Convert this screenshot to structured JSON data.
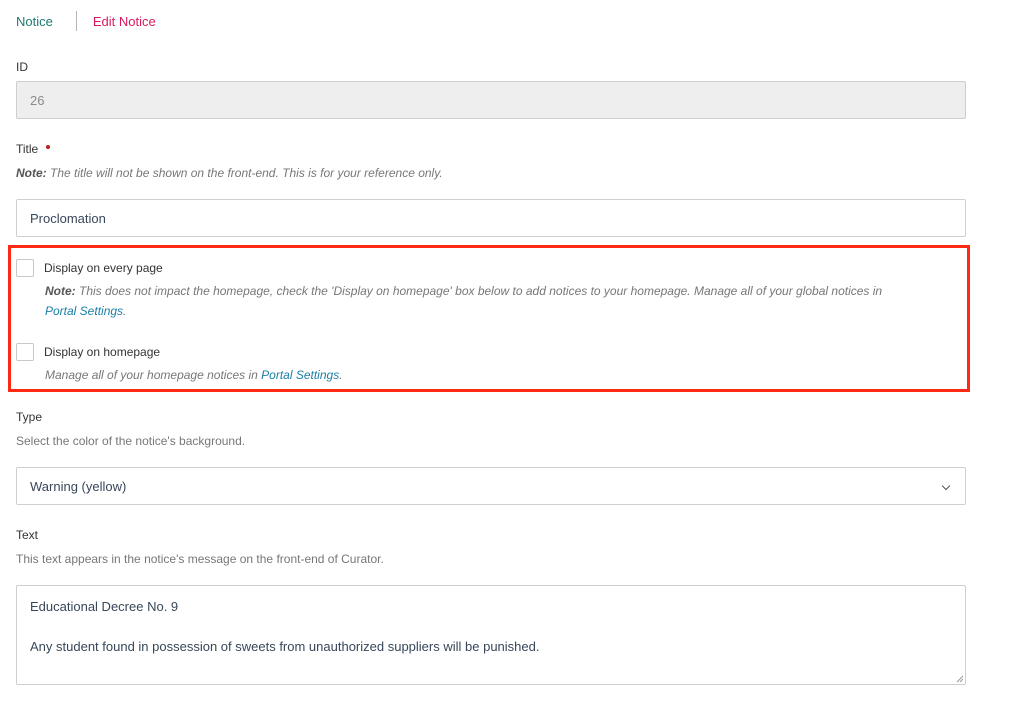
{
  "breadcrumb": {
    "root": "Notice",
    "current": "Edit Notice"
  },
  "id_field": {
    "label": "ID",
    "value": "26"
  },
  "title_field": {
    "label": "Title",
    "note_prefix": "Note:",
    "note": "The title will not be shown on the front-end. This is for your reference only.",
    "value": "Proclomation"
  },
  "display_every_page": {
    "label": "Display on every page",
    "checked": false,
    "note_prefix": "Note:",
    "note": "This does not impact the homepage, check the 'Display on homepage' box below to add notices to your homepage. Manage all of your global notices in",
    "link": "Portal Settings",
    "suffix": "."
  },
  "display_homepage": {
    "label": "Display on homepage",
    "checked": false,
    "note": "Manage all of your homepage notices in",
    "link": "Portal Settings",
    "suffix": "."
  },
  "type_field": {
    "label": "Type",
    "hint": "Select the color of the notice's background.",
    "selected": "Warning (yellow)"
  },
  "text_field": {
    "label": "Text",
    "hint": "This text appears in the notice's message on the front-end of Curator.",
    "line1": "Educational Decree No. 9",
    "line2": "Any student found in possession of sweets from unauthorized suppliers will be punished."
  },
  "colors": {
    "brand_teal": "#1f7a72",
    "active_pink": "#d81b60",
    "link_blue": "#1a7ea6",
    "highlight_red": "#ff2a14"
  }
}
